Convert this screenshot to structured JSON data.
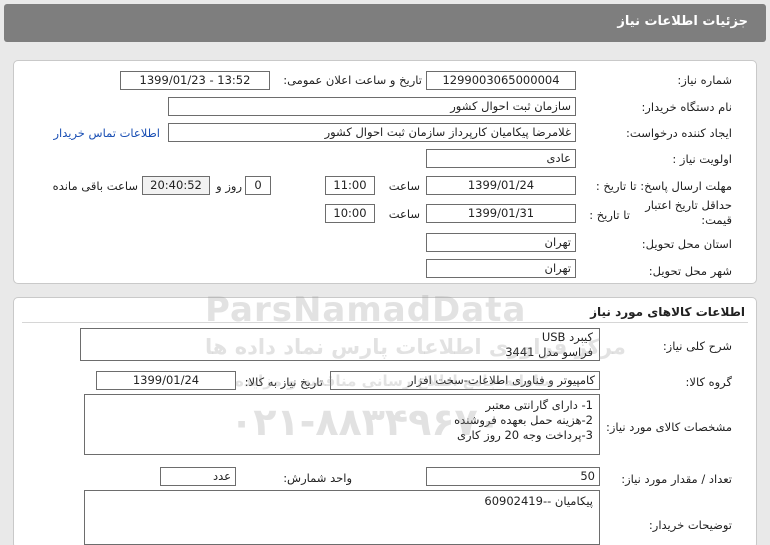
{
  "header": {
    "title": "جزئیات اطلاعات نیاز"
  },
  "need_info": {
    "need_number_label": "شماره نیاز:",
    "need_number": "1299003065000004",
    "announce_label": "تاریخ و ساعت اعلان عمومی:",
    "announce_value": "1399/01/23 - 13:52",
    "buyer_org_label": "نام دستگاه خریدار:",
    "buyer_org": "سازمان ثبت احوال کشور",
    "creator_label": "ایجاد کننده درخواست:",
    "creator": "غلامرضا پیکامیان کارپرداز سازمان ثبت احوال کشور",
    "contact_link": "اطلاعات تماس خریدار",
    "priority_label": "اولویت نیاز :",
    "priority": "عادی",
    "reply_deadline_label": "مهلت ارسال پاسخ: تا تاریخ :",
    "reply_date": "1399/01/24",
    "time_label": "ساعت",
    "reply_time": "11:00",
    "days": "0",
    "days_label": "روز و",
    "remaining_time": "20:40:52",
    "remaining_label": "ساعت باقی مانده",
    "validity_label": "حداقل تاریخ اعتبار قیمت:",
    "validity_to_label": "تا تاریخ :",
    "validity_date": "1399/01/31",
    "validity_time": "10:00",
    "province_label": "استان محل تحویل:",
    "province": "تهران",
    "city_label": "شهر محل تحویل:",
    "city": "تهران"
  },
  "goods": {
    "section_title": "اطلاعات کالاهای مورد نیاز",
    "general_desc_label": "شرح کلی نیاز:",
    "general_desc": "کیبرد USB\nفراسو مدل 3441",
    "group_label": "گروه کالا:",
    "group": "کامپیوتر و فناوری اطلاعات-سخت افزار",
    "need_date_label": "تاریخ نیاز به کالا:",
    "need_date": "1399/01/24",
    "specs_label": "مشخصات کالای مورد نیاز:",
    "specs": "1- دارای گارانتی معتبر\n2-هزینه حمل بعهده فروشنده\n3-پرداخت وجه 20 روز کاری",
    "qty_label": "تعداد / مقدار مورد نیاز:",
    "qty": "50",
    "unit_label": "واحد شمارش:",
    "unit": "عدد",
    "buyer_notes_label": "توضیحات خریدار:",
    "buyer_notes": "پیکامیان --60902419"
  },
  "watermark": {
    "brand": "ParsNamadData",
    "line1": "مرکز فراوری اطلاعات پارس نماد داده ها",
    "line2": "سامانه جامع اطلاع رسانی مناقصه و مزایده",
    "phone": "۰۲۱-۸۸۳۴۹۶۷۰"
  }
}
